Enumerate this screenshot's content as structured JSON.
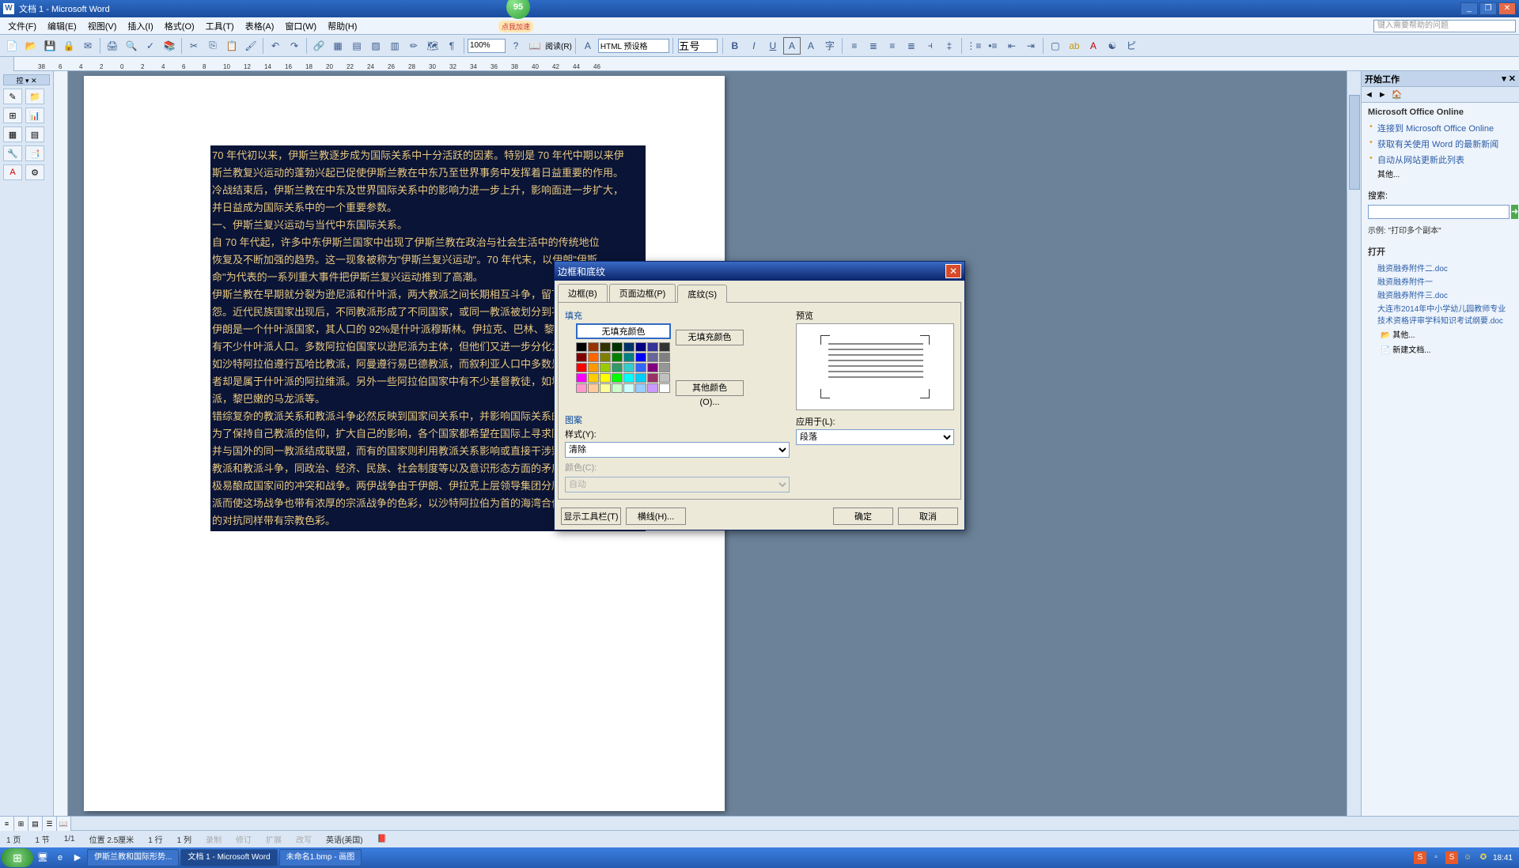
{
  "title": "文档 1 - Microsoft Word",
  "bubble": {
    "num": "95",
    "label": "点我加速"
  },
  "menus": [
    "文件(F)",
    "编辑(E)",
    "视图(V)",
    "插入(I)",
    "格式(O)",
    "工具(T)",
    "表格(A)",
    "窗口(W)",
    "帮助(H)"
  ],
  "help_placeholder": "键入需要帮助的问题",
  "zoom": "100%",
  "read_label": "阅读(R)",
  "html_label": "HTML 预设格",
  "fontsize": "五号",
  "ruler_ticks": [
    38,
    6,
    4,
    2,
    0,
    2,
    4,
    6,
    8,
    10,
    12,
    14,
    16,
    18,
    20,
    22,
    24,
    26,
    28,
    30,
    32,
    34,
    36,
    38,
    40,
    42,
    44,
    46
  ],
  "doc_text_lines": [
    "70 年代初以来，伊斯兰教逐步成为国际关系中十分活跃的因素。特别是 70 年代中期以来伊",
    "斯兰教复兴运动的蓬勃兴起已促使伊斯兰教在中东乃至世界事务中发挥着日益重要的作用。",
    "冷战结束后，伊斯兰教在中东及世界国际关系中的影响力进一步上升，影响面进一步扩大，",
    "并日益成为国际关系中的一个重要参数。",
    "一、伊斯兰复兴运动与当代中东国际关系。",
    "自 70 年代起，许多中东伊斯兰国家中出现了伊斯兰教在政治与社会生活中的传统地位",
    "恢复及不断加强的趋势。这一现象被称为\"伊斯兰复兴运动\"。70 年代末，以伊朗\"伊斯",
    "命\"为代表的一系列重大事件把伊斯兰复兴运动推到了高潮。",
    "伊斯兰教在早期就分裂为逊尼派和什叶派，两大教派之间长期相互斗争，留下了不少宿",
    "怨。近代民族国家出现后，不同教派形成了不同国家，或同一教派被划分到不同的国家",
    "伊朗是一个什叶派国家，其人口的 92%是什叶派穆斯林。伊拉克、巴林、黎巴",
    "有不少什叶派人口。多数阿拉伯国家以逊尼派为主体，但他们又进一步分化为一些小的",
    "如沙特阿拉伯遵行瓦哈比教派，阿曼遵行易巴德教派，而叙利亚人口中多数是逊尼派",
    "者却是属于什叶派的阿拉维派。另外一些阿拉伯国家中有不少基督教徒，如埃及的科",
    "派，黎巴嫩的马龙派等。",
    "错综复杂的教派关系和教派斗争必然反映到国家间关系中，并影响国际关系的变化和",
    "为了保持自己教派的信仰，扩大自己的影响，各个国家都希望在国际上寻求同一教派",
    "并与国外的同一教派结成联盟，而有的国家则利用教派关系影响或直接干涉别国内部",
    "教派和教派斗争，同政治、经济、民族、社会制度等以及意识形态方面的矛盾混合在",
    "极易酿成国家间的冲突和战争。两伊战争由于伊朗、伊拉克上层领导集团分属什叶派和",
    "派而使这场战争也带有浓厚的宗派战争的色彩，以沙特阿拉伯为首的海湾合作委员会与伊朗",
    "的对抗同样带有宗教色彩。"
  ],
  "dialog": {
    "title": "边框和底纹",
    "tabs": [
      "边框(B)",
      "页面边框(P)",
      "底纹(S)"
    ],
    "fill_label": "填充",
    "nofill": "无填充颜色",
    "nofill_btn": "无填充颜色",
    "more_colors": "其他颜色(O)...",
    "pattern_label": "图案",
    "style_label": "样式(Y):",
    "style_value": "清除",
    "color_label": "颜色(C):",
    "color_value": "自动",
    "preview_label": "预览",
    "apply_label": "应用于(L):",
    "apply_value": "段落",
    "show_toolbar": "显示工具栏(T)",
    "hline": "横线(H)...",
    "ok": "确定",
    "cancel": "取消",
    "palette": [
      "#000000",
      "#993300",
      "#333300",
      "#003300",
      "#003366",
      "#000080",
      "#333399",
      "#333333",
      "#800000",
      "#FF6600",
      "#808000",
      "#008000",
      "#008080",
      "#0000FF",
      "#666699",
      "#808080",
      "#FF0000",
      "#FF9900",
      "#99CC00",
      "#339966",
      "#33CCCC",
      "#3366FF",
      "#800080",
      "#969696",
      "#FF00FF",
      "#FFCC00",
      "#FFFF00",
      "#00FF00",
      "#00FFFF",
      "#00CCFF",
      "#993366",
      "#C0C0C0",
      "#FF99CC",
      "#FFCC99",
      "#FFFF99",
      "#CCFFCC",
      "#CCFFFF",
      "#99CCFF",
      "#CC99FF",
      "#FFFFFF"
    ]
  },
  "taskpane": {
    "header": "开始工作",
    "office": "Microsoft Office Online",
    "links": [
      "连接到 Microsoft Office Online",
      "获取有关使用 Word 的最新新闻",
      "自动从网站更新此列表",
      "其他..."
    ],
    "search_label": "搜索:",
    "example": "示例:  \"打印多个副本\"",
    "open_label": "打开",
    "files": [
      "融资融券附件二.doc",
      "融资融券附件一",
      "融资融券附件三.doc",
      "大连市2014年中小学幼儿园教师专业技术资格评审学科知识考试纲要.doc"
    ],
    "other": "其他...",
    "newdoc": "新建文档..."
  },
  "status": {
    "page": "1 页",
    "sec": "1 节",
    "pages": "1/1",
    "pos": "位置 2.5厘米",
    "line": "1 行",
    "col": "1 列",
    "rec": "录制",
    "rev": "修订",
    "ext": "扩展",
    "ovr": "改写",
    "lang": "英语(美国)"
  },
  "taskbar": {
    "tasks": [
      "伊斯兰教和国际形势...",
      "文档 1 - Microsoft Word",
      "未命名1.bmp - 画图"
    ],
    "clock": "18:41"
  }
}
